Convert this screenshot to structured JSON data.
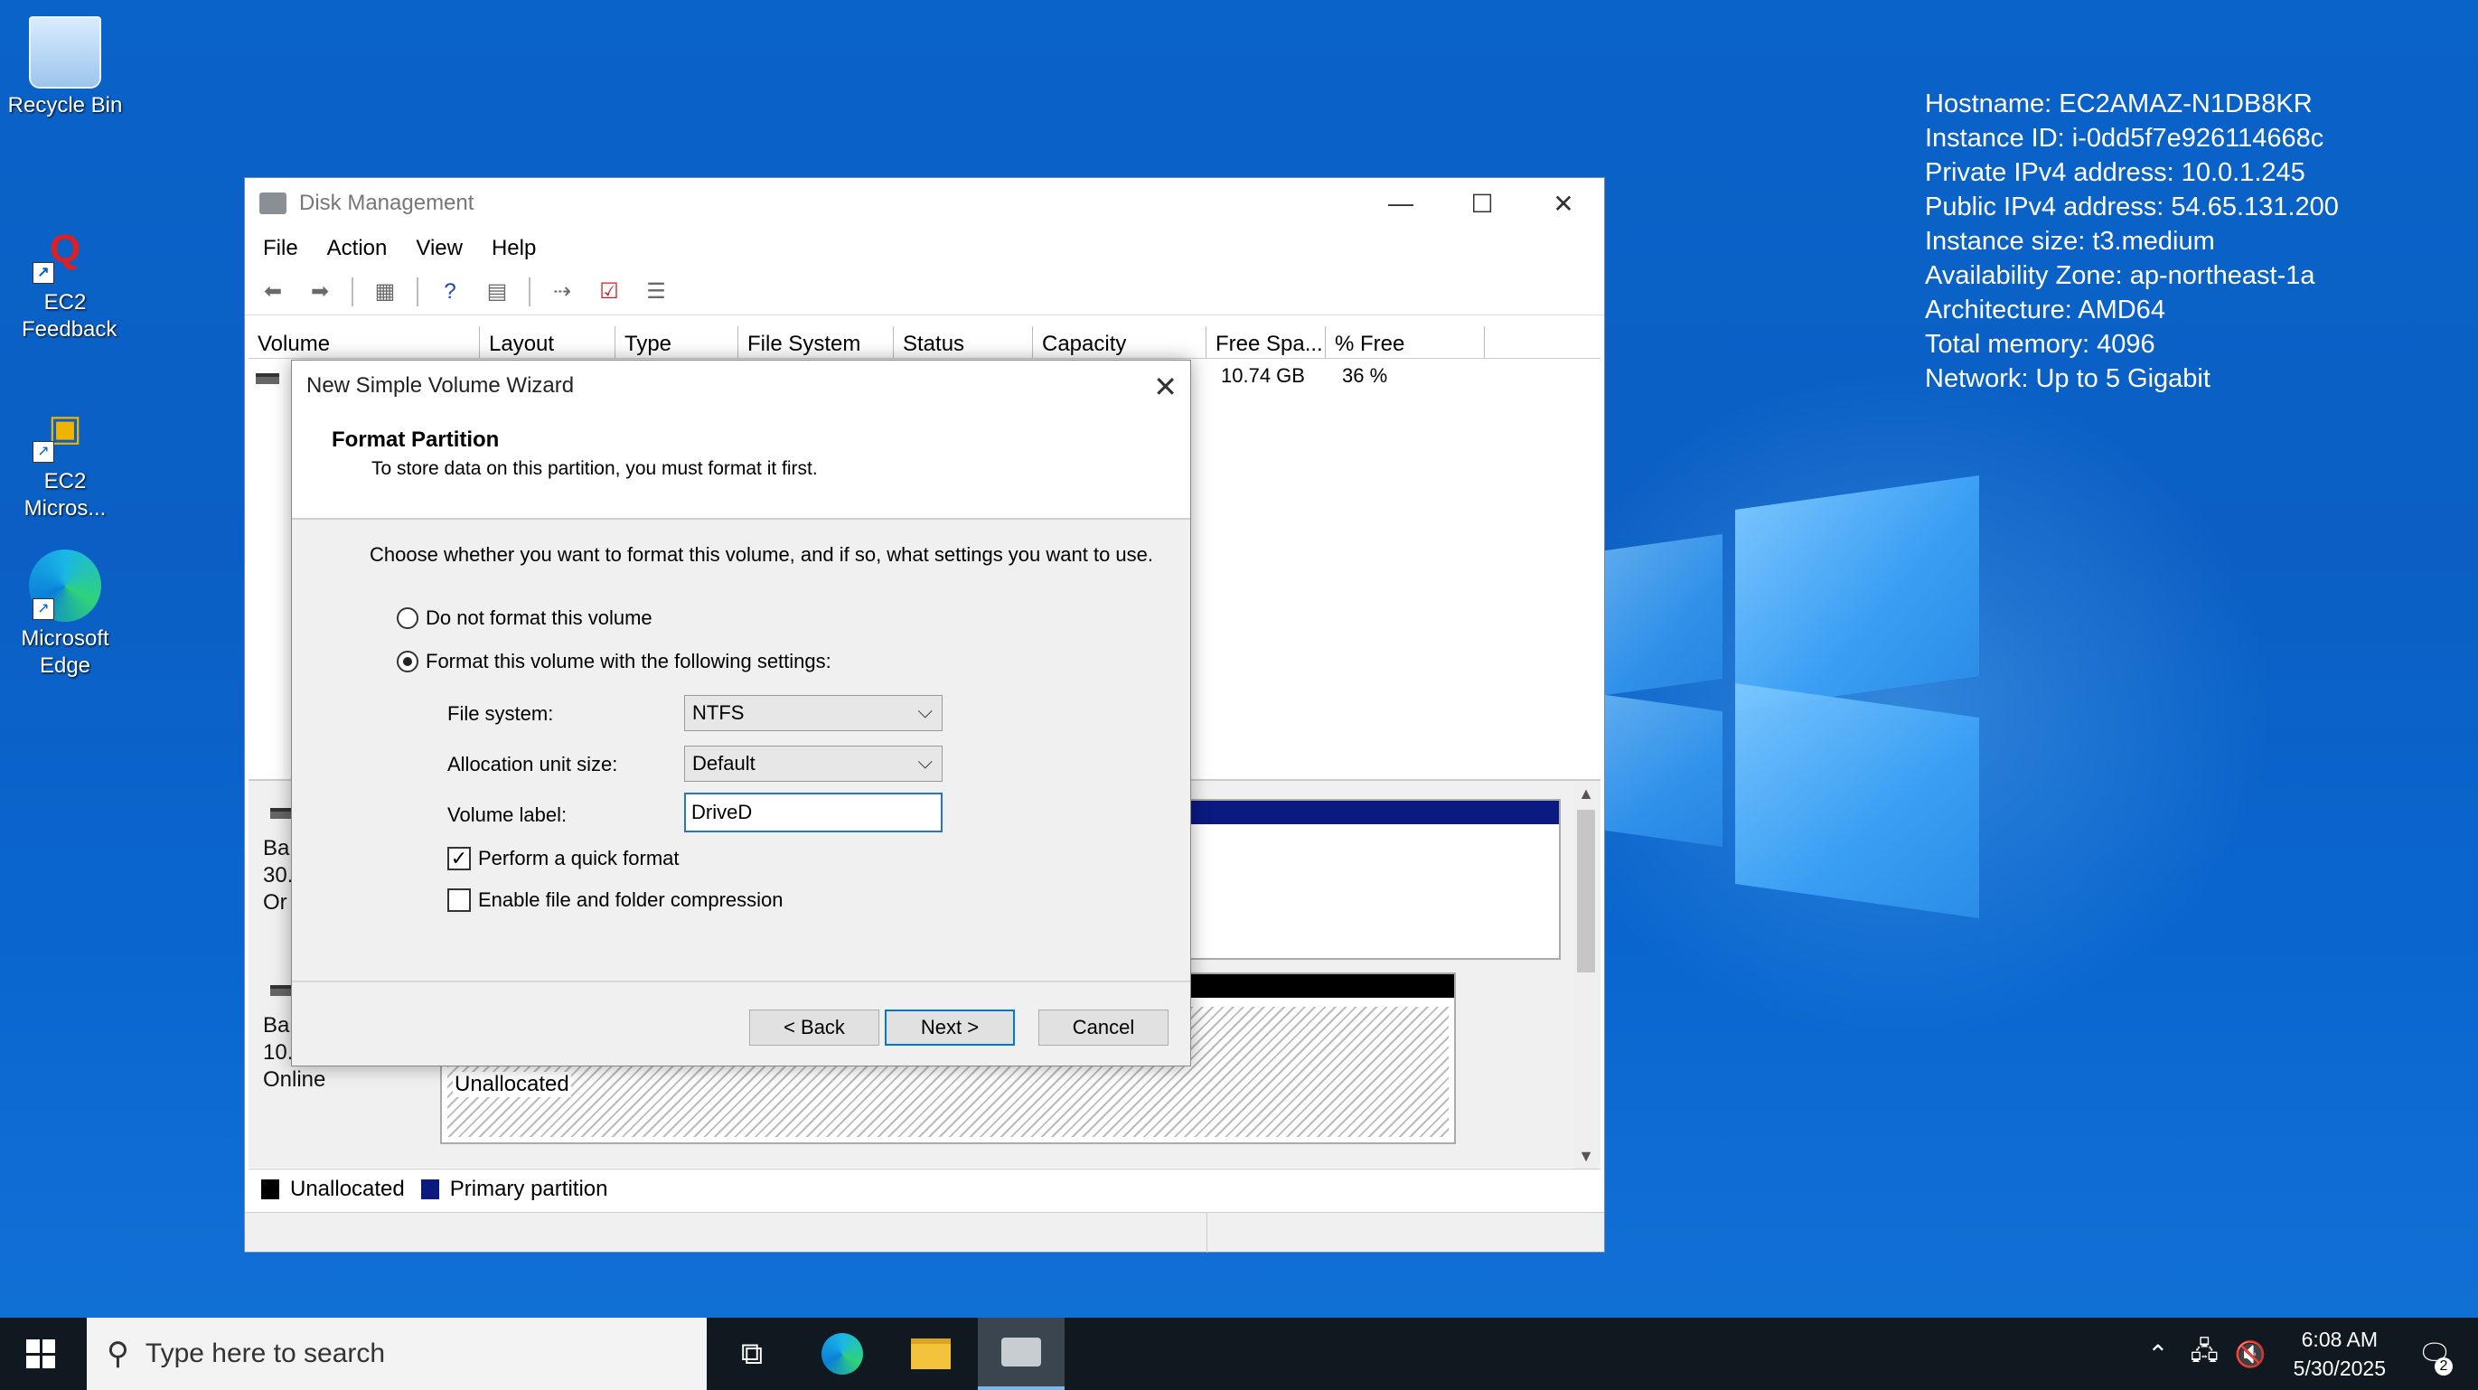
{
  "desktop": {
    "icons": [
      {
        "label": "Recycle Bin",
        "icon": "recycle-bin-icon"
      },
      {
        "label": "EC2 Feedback",
        "icon": "feedback-icon"
      },
      {
        "label": "EC2 Micros...",
        "icon": "package-icon"
      },
      {
        "label": "Microsoft Edge",
        "icon": "edge-icon"
      }
    ],
    "info": [
      "Hostname: EC2AMAZ-N1DB8KR",
      "Instance ID: i-0dd5f7e926114668c",
      "Private IPv4 address: 10.0.1.245",
      "Public IPv4 address: 54.65.131.200",
      "Instance size: t3.medium",
      "Availability Zone: ap-northeast-1a",
      "Architecture: AMD64",
      "Total memory: 4096",
      "Network: Up to 5 Gigabit"
    ]
  },
  "disk_mgmt": {
    "title": "Disk Management",
    "menu": [
      "File",
      "Action",
      "View",
      "Help"
    ],
    "columns": [
      "Volume",
      "Layout",
      "Type",
      "File System",
      "Status",
      "Capacity",
      "Free Spa...",
      "% Free"
    ],
    "row": {
      "free_space": "10.74 GB",
      "pct_free": "36 %"
    },
    "disks": [
      {
        "line1": "Ba",
        "line2": "30.",
        "line3": "Or"
      },
      {
        "line1": "Ba",
        "line2": "10.",
        "line3": "Online",
        "partition_label": "Unallocated"
      }
    ],
    "legend": [
      {
        "label": "Unallocated",
        "color": "#000000"
      },
      {
        "label": "Primary partition",
        "color": "#0a1a80"
      }
    ]
  },
  "wizard": {
    "title": "New Simple Volume Wizard",
    "heading": "Format Partition",
    "subheading": "To store data on this partition, you must format it first.",
    "description": "Choose whether you want to format this volume, and if so, what settings you want to use.",
    "radio_no_format": "Do not format this volume",
    "radio_format": "Format this volume with the following settings:",
    "file_system_label": "File system:",
    "file_system_value": "NTFS",
    "alloc_label": "Allocation unit size:",
    "alloc_value": "Default",
    "volume_label_label": "Volume label:",
    "volume_label_value": "DriveD",
    "quick_format": "Perform a quick format",
    "compression": "Enable file and folder compression",
    "back": "< Back",
    "next": "Next >",
    "cancel": "Cancel"
  },
  "taskbar": {
    "search_placeholder": "Type here to search",
    "time": "6:08 AM",
    "date": "5/30/2025",
    "notification_count": "2"
  }
}
